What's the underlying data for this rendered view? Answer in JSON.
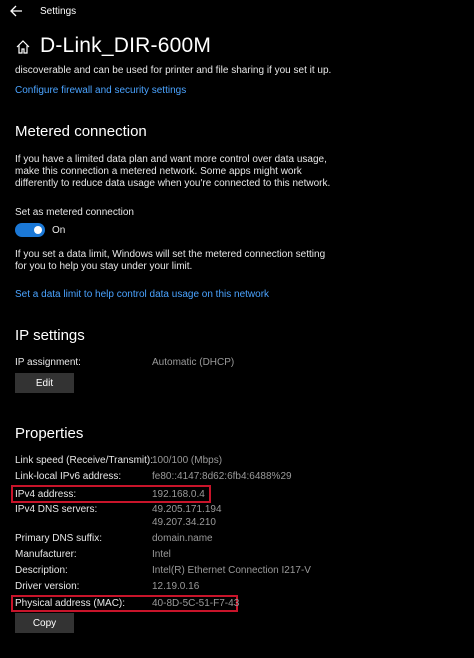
{
  "window": {
    "app_title": "Settings"
  },
  "page": {
    "title": "D-Link_DIR-600M"
  },
  "intro": {
    "truncated_text": "discoverable and can be used for printer and file sharing if you set it up.",
    "firewall_link": "Configure firewall and security settings"
  },
  "metered": {
    "heading": "Metered connection",
    "description_lines": [
      "If you have a limited data plan and want more control over data usage,",
      "make this connection a metered network. Some apps might work",
      "differently to reduce data usage when you're connected to this network."
    ],
    "toggle_label": "Set as metered connection",
    "toggle_state": "On",
    "limit_lines": [
      "If you set a data limit, Windows will set the metered connection setting",
      "for you to help you stay under your limit."
    ],
    "data_limit_link": "Set a data limit to help control data usage on this network"
  },
  "ip_settings": {
    "heading": "IP settings",
    "assignment_label": "IP assignment:",
    "assignment_value": "Automatic (DHCP)",
    "edit_label": "Edit"
  },
  "properties": {
    "heading": "Properties",
    "rows": [
      {
        "label": "Link speed (Receive/Transmit):",
        "value": "100/100 (Mbps)"
      },
      {
        "label": "Link-local IPv6 address:",
        "value": "fe80::4147:8d62:6fb4:6488%29"
      },
      {
        "label": "IPv4 address:",
        "value": "192.168.0.4"
      },
      {
        "label": "IPv4 DNS servers:",
        "value": "49.205.171.194",
        "value2": "49.207.34.210"
      },
      {
        "label": "Primary DNS suffix:",
        "value": "domain.name"
      },
      {
        "label": "Manufacturer:",
        "value": "Intel"
      },
      {
        "label": "Description:",
        "value": "Intel(R) Ethernet Connection I217-V"
      },
      {
        "label": "Driver version:",
        "value": "12.19.0.16"
      },
      {
        "label": "Physical address (MAC):",
        "value": "40-8D-5C-51-F7-43"
      }
    ],
    "copy_label": "Copy"
  },
  "icons": {
    "back": "back-arrow-icon",
    "home": "home-icon"
  },
  "colors": {
    "accent": "#1b78d6",
    "link": "#4aa3ff",
    "highlight": "#c8142a",
    "button": "#333333"
  }
}
